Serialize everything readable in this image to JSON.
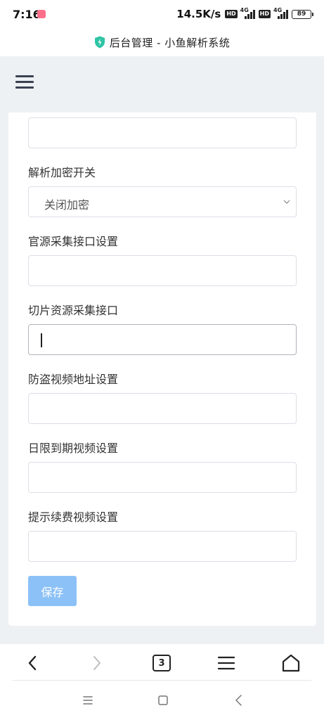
{
  "status_bar": {
    "time": "7:16",
    "speed": "14.5K/s",
    "hd_badge": "HD",
    "network_label": "4G",
    "battery": "89"
  },
  "title_bar": {
    "title": "后台管理 - 小鱼解析系统",
    "icon": "shield-icon"
  },
  "form": {
    "fields": [
      {
        "label": "",
        "value": ""
      },
      {
        "label": "解析加密开关",
        "type": "select",
        "value": "关闭加密"
      },
      {
        "label": "官源采集接口设置",
        "value": ""
      },
      {
        "label": "切片资源采集接口",
        "value": "",
        "focused": true
      },
      {
        "label": "防盗视频地址设置",
        "value": ""
      },
      {
        "label": "日限到期视频设置",
        "value": ""
      },
      {
        "label": "提示续费视频设置",
        "value": ""
      }
    ],
    "save_label": "保存"
  },
  "browser_toolbar": {
    "tab_count": "3",
    "icons": [
      "back-icon",
      "forward-icon",
      "tabs-icon",
      "menu-icon",
      "home-icon"
    ]
  },
  "colors": {
    "save_button": "#8cc1f7",
    "header_bg": "#eef1f4",
    "shield": "#2ec4a5"
  }
}
